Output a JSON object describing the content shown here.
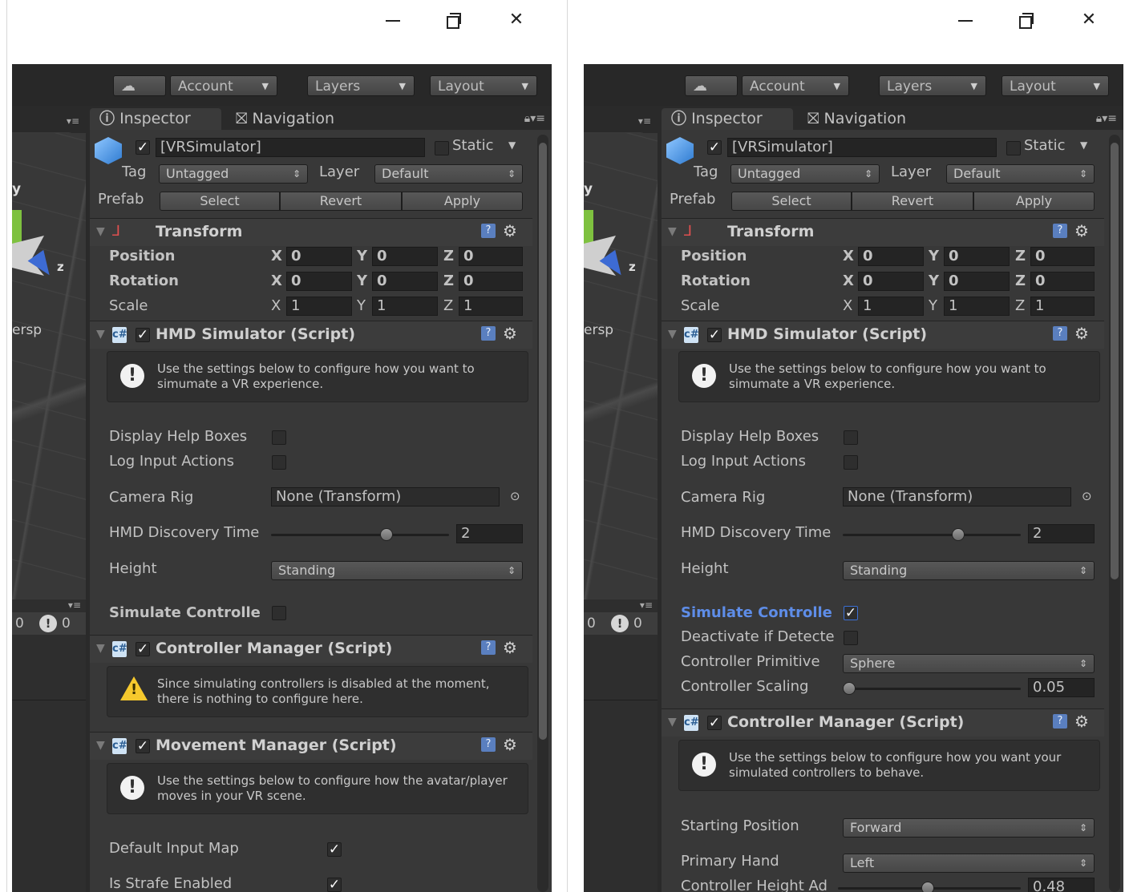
{
  "toolbar": {
    "account_label": "Account",
    "layers_label": "Layers",
    "layout_label": "Layout"
  },
  "tabs": {
    "inspector": "Inspector",
    "navigation": "Navigation"
  },
  "object": {
    "name": "[VRSimulator]",
    "static_label": "Static",
    "tag_label": "Tag",
    "tag_value": "Untagged",
    "layer_label": "Layer",
    "layer_value": "Default",
    "prefab_label": "Prefab",
    "prefab_select": "Select",
    "prefab_revert": "Revert",
    "prefab_apply": "Apply"
  },
  "scene": {
    "axis_z": "z",
    "axis_y": "y",
    "persp": "ersp",
    "counter_a": "0",
    "counter_b": "0"
  },
  "transform": {
    "title": "Transform",
    "rows": [
      {
        "label": "Position",
        "x": "0",
        "y": "0",
        "z": "0"
      },
      {
        "label": "Rotation",
        "x": "0",
        "y": "0",
        "z": "0"
      },
      {
        "label": "Scale",
        "x": "1",
        "y": "1",
        "z": "1"
      }
    ],
    "axis_x": "X",
    "axis_y": "Y",
    "axis_z": "Z"
  },
  "hmd": {
    "title": "HMD Simulator (Script)",
    "help": "Use the settings below to configure how you want to simumate a VR experience.",
    "display_help_label": "Display Help Boxes",
    "log_input_label": "Log Input Actions",
    "camera_rig_label": "Camera Rig",
    "camera_rig_value": "None (Transform)",
    "discovery_label": "HMD Discovery Time",
    "discovery_value": "2",
    "height_label": "Height",
    "height_value": "Standing",
    "simulate_label": "Simulate Controlle"
  },
  "left": {
    "controller_title": "Controller Manager (Script)",
    "controller_warn": "Since simulating controllers is disabled at the moment, there is nothing to configure here.",
    "movement_title": "Movement Manager (Script)",
    "movement_help": "Use the settings below to configure how the avatar/player moves in your VR scene.",
    "default_input_label": "Default Input Map",
    "strafe_label": "Is Strafe Enabled"
  },
  "right": {
    "deactivate_label": "Deactivate if Detecte",
    "primitive_label": "Controller Primitive",
    "primitive_value": "Sphere",
    "scaling_label": "Controller Scaling",
    "scaling_value": "0.05",
    "controller_title": "Controller Manager (Script)",
    "controller_help": "Use the settings below to configure how you want your simulated controllers to behave.",
    "starting_label": "Starting Position",
    "starting_value": "Forward",
    "primary_label": "Primary Hand",
    "primary_value": "Left",
    "height_adj_label": "Controller Height Ad",
    "height_adj_value": "0.48"
  },
  "state": {
    "hmd_discovery_slider": 0.5,
    "controller_scaling_slider": 0.0,
    "controller_height_slider": 0.48
  }
}
